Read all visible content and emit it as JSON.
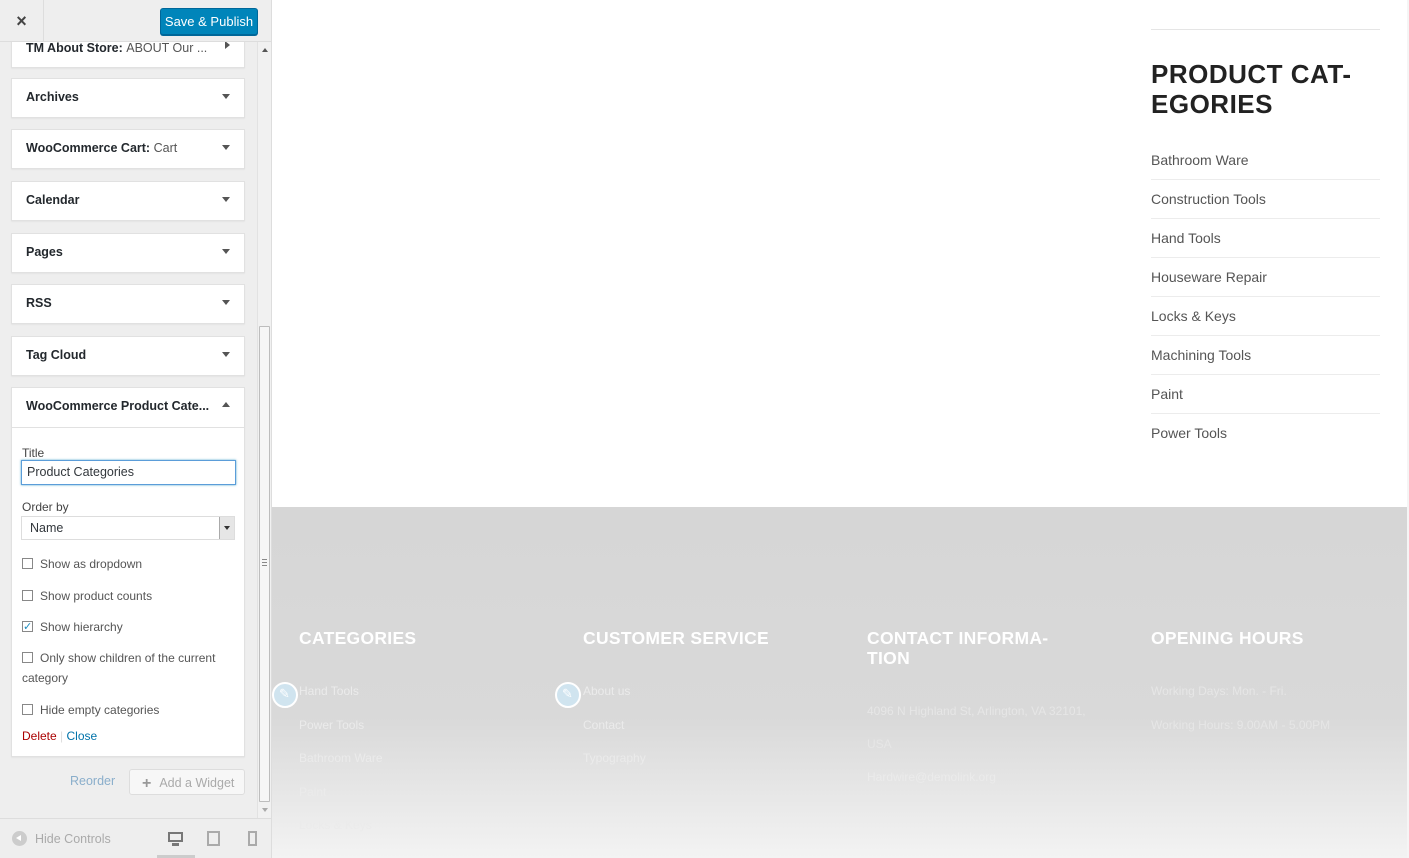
{
  "header": {
    "close_icon": "×",
    "publish_label": "Save & Publish"
  },
  "widgets": [
    {
      "name": "TM About Store:",
      "subtitle": "ABOUT Our ..."
    },
    {
      "name": "Archives",
      "subtitle": ""
    },
    {
      "name": "WooCommerce Cart:",
      "subtitle": "Cart"
    },
    {
      "name": "Calendar",
      "subtitle": ""
    },
    {
      "name": "Pages",
      "subtitle": ""
    },
    {
      "name": "RSS",
      "subtitle": ""
    },
    {
      "name": "Tag Cloud",
      "subtitle": ""
    }
  ],
  "open_widget": {
    "name": "WooCommerce Product Cate...",
    "title_label": "Title",
    "title_value": "Product Categories",
    "order_label": "Order by",
    "order_value": "Name",
    "checkboxes": [
      {
        "label": "Show as dropdown",
        "checked": false
      },
      {
        "label": "Show product counts",
        "checked": false
      },
      {
        "label": "Show hierarchy",
        "checked": true
      },
      {
        "label": "Only show children of the current category",
        "checked": false
      },
      {
        "label": "Hide empty categories",
        "checked": false
      }
    ],
    "delete_label": "Delete",
    "separator": "|",
    "close_label": "Close"
  },
  "actions": {
    "reorder_label": "Reorder",
    "add_widget_label": "Add a Widget"
  },
  "footer_bar": {
    "hide_controls_label": "Hide Controls",
    "devices": [
      "desktop-icon",
      "tablet-icon",
      "mobile-icon"
    ]
  },
  "preview": {
    "sidebar_title": "PRODUCT CAT-\nEGORIES",
    "categories": [
      "Bathroom Ware",
      "Construction Tools",
      "Hand Tools",
      "Houseware Repair",
      "Locks & Keys",
      "Machining Tools",
      "Paint",
      "Power Tools"
    ],
    "footer_columns": [
      {
        "heading": "CATEGORIES",
        "links": [
          "Hand Tools",
          "Power Tools",
          "Bathroom Ware",
          "Paint",
          "Locks & Keys"
        ]
      },
      {
        "heading": "CUSTOMER SERVICE",
        "links": [
          "About us",
          "Contact",
          "Typography"
        ]
      },
      {
        "heading": "CONTACT INFORMA-\nTION",
        "links": [
          "4096 N Highland St, Arlington, VA 32101,",
          "USA",
          "Hardwire@demolink.org"
        ]
      },
      {
        "heading": "OPENING HOURS",
        "links": [
          "Working Days: Mon. - Fri.",
          "Working Hours: 9.00AM - 5.00PM"
        ]
      }
    ]
  },
  "colors": {
    "publish_button": "#0085ba",
    "delete_link": "#aa0000",
    "close_link": "#0073aa",
    "footer_background": "#d6d6d6"
  }
}
